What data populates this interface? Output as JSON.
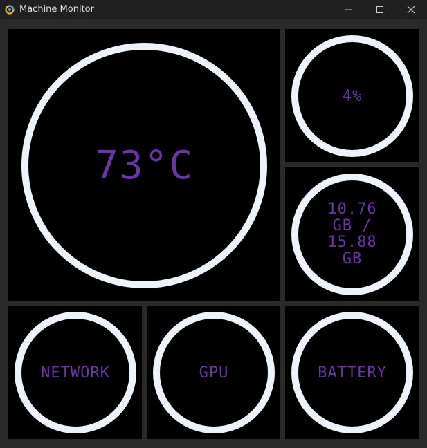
{
  "window": {
    "title": "Machine Monitor"
  },
  "tiles": {
    "temperature": {
      "label": "73°C"
    },
    "cpu": {
      "label": "4%"
    },
    "memory": {
      "lines": [
        "10.76",
        "GB /",
        "15.88",
        "GB"
      ]
    },
    "network": {
      "label": "NETWORK"
    },
    "gpu": {
      "label": "GPU"
    },
    "battery": {
      "label": "BATTERY"
    }
  },
  "colors": {
    "ring": "#eef3fb",
    "label": "#6a35a6",
    "tile_bg": "#000000",
    "frame_bg": "#2a2a2a"
  },
  "icons": {
    "app": "app-logo-icon",
    "minimize": "minimize-icon",
    "maximize": "maximize-icon",
    "close": "close-icon"
  }
}
